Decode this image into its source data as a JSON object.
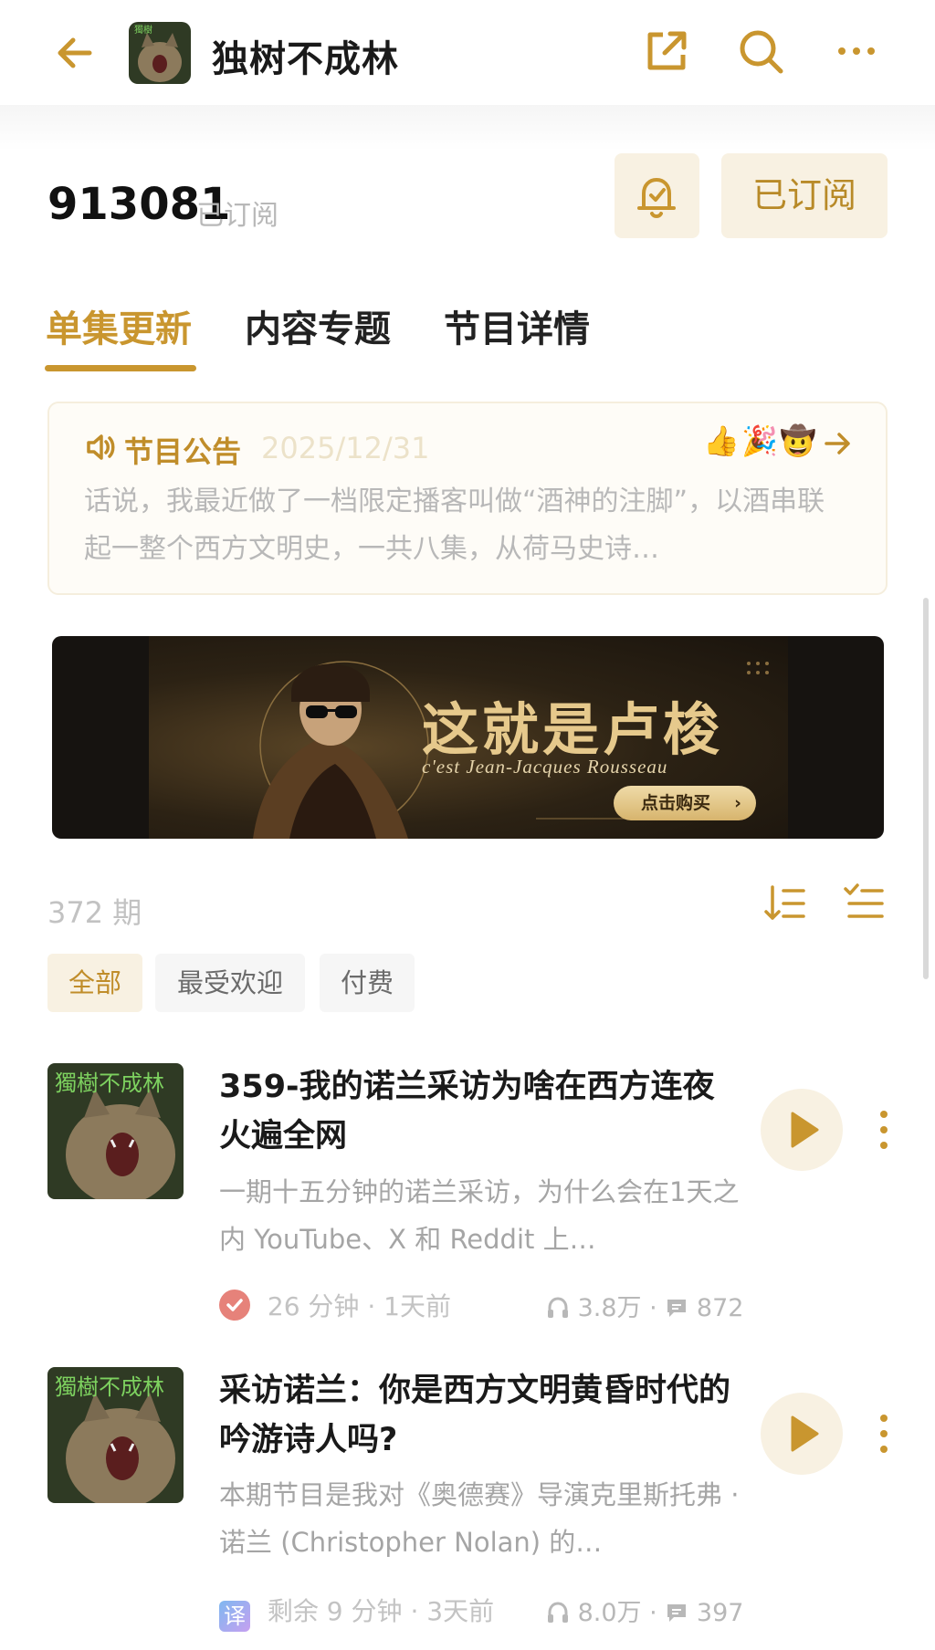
{
  "header": {
    "podcast_name": "独树不成林",
    "icons": [
      "back-arrow-icon",
      "share-icon",
      "search-icon",
      "more-icon"
    ]
  },
  "subscription": {
    "count": "913081",
    "label": "已订阅",
    "button_label": "已订阅",
    "bell_icon": "bell-icon"
  },
  "tabs": [
    {
      "label": "单集更新",
      "active": true
    },
    {
      "label": "内容专题",
      "active": false
    },
    {
      "label": "节目详情",
      "active": false
    }
  ],
  "announcement": {
    "title": "节目公告",
    "date": "2025/12/31",
    "emojis": [
      "👍",
      "🎉",
      "🤠"
    ],
    "body": "话说，我最近做了一档限定播客叫做“酒神的注脚”，以酒串联起一整个西方文明史，一共八集，从荷马史诗…"
  },
  "banner": {
    "title": "这就是卢梭",
    "subtitle": "c'est Jean-Jacques Rousseau",
    "button_label": "点击购买"
  },
  "episodes_header": {
    "count_label": "372 期",
    "icons": [
      "sort-order-icon",
      "multi-select-icon"
    ]
  },
  "filters": [
    {
      "label": "全部",
      "active": true
    },
    {
      "label": "最受欢迎",
      "active": false
    },
    {
      "label": "付费",
      "active": false
    }
  ],
  "episodes": [
    {
      "title": "359-我的诺兰采访为啥在西方连夜火遍全网",
      "description": "一期十五分钟的诺兰采访，为什么会在1天之内 YouTube、X 和 Reddit 上…",
      "badge_icon": "played-check-icon",
      "duration": "26 分钟",
      "date": "1天前",
      "plays": "3.8万",
      "comments": "872"
    },
    {
      "title": "采访诺兰：你是西方文明黄昏时代的吟游诗人吗?",
      "description": "本期节目是我对《奥德赛》导演克里斯托弗 · 诺兰 (Christopher Nolan) 的…",
      "badge_icon": "translate-icon",
      "badge_text": "译",
      "duration": "剩余 9 分钟",
      "date": "3天前",
      "plays": "8.0万",
      "comments": "397"
    }
  ],
  "colors": {
    "accent": "#c9962f",
    "accent_bg": "#f8f1e2",
    "muted": "#b8b8b8",
    "text": "#1a1a1a"
  }
}
